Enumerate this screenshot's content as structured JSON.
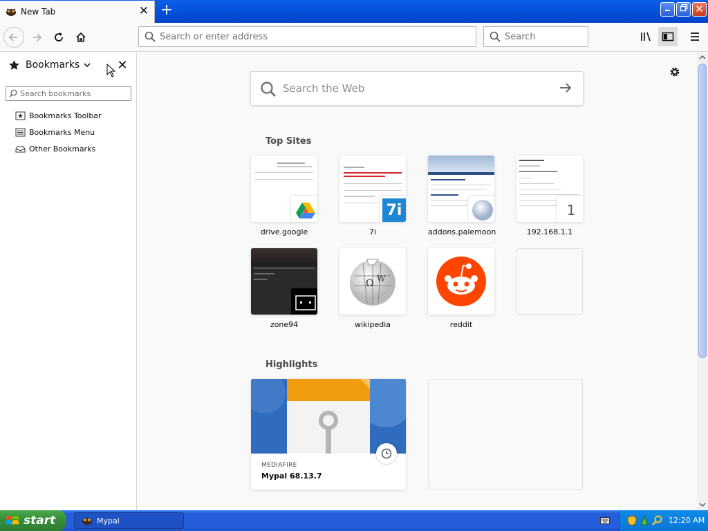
{
  "window": {
    "tab_title": "New Tab",
    "tab_close": "✕",
    "newtab": "+",
    "buttons": {
      "minimize": "_",
      "maximize": "❐",
      "close": "✕"
    }
  },
  "navbar": {
    "url_placeholder": "Search or enter address",
    "url_value": "",
    "search_placeholder": "Search",
    "search_value": "",
    "icons": [
      "back-arrow-icon",
      "forward-arrow-icon",
      "reload-icon",
      "home-icon",
      "library-icon",
      "sidebar-icon",
      "menu-icon"
    ]
  },
  "sidebar": {
    "title": "Bookmarks",
    "chevron": "⌄",
    "close": "✕",
    "search_placeholder": "Search bookmarks",
    "items": [
      {
        "label": "Bookmarks Toolbar",
        "icon": "bookmarks-toolbar-icon"
      },
      {
        "label": "Bookmarks Menu",
        "icon": "bookmarks-menu-icon"
      },
      {
        "label": "Other Bookmarks",
        "icon": "other-bookmarks-icon"
      }
    ]
  },
  "content": {
    "websearch_placeholder": "Search the Web",
    "top_sites_title": "Top Sites",
    "top_sites": [
      {
        "label": "drive.google",
        "icon": "google-drive-icon"
      },
      {
        "label": "7i",
        "icon": "7i-icon",
        "icon_text": "7i"
      },
      {
        "label": "addons.palemoon",
        "icon": "palemoon-icon"
      },
      {
        "label": "192.168.1.1",
        "icon": "number-icon",
        "icon_text": "1"
      },
      {
        "label": "zone94",
        "icon": "zone94-icon"
      },
      {
        "label": "wikipedia",
        "icon": "wikipedia-icon",
        "icon_text": "W"
      },
      {
        "label": "reddit",
        "icon": "reddit-icon"
      },
      {
        "label": "",
        "icon": ""
      }
    ],
    "highlights_title": "Highlights",
    "highlight": {
      "host": "MEDIAFIRE",
      "title": "Mypal 68.13.7"
    }
  },
  "taskbar": {
    "start_label": "start",
    "task_label": "Mypal",
    "clock": "12:20 AM"
  },
  "colors": {
    "accent": "#0060df",
    "titlebar": "#0453dd",
    "reddit": "#ff4500",
    "start": "#37903a"
  }
}
